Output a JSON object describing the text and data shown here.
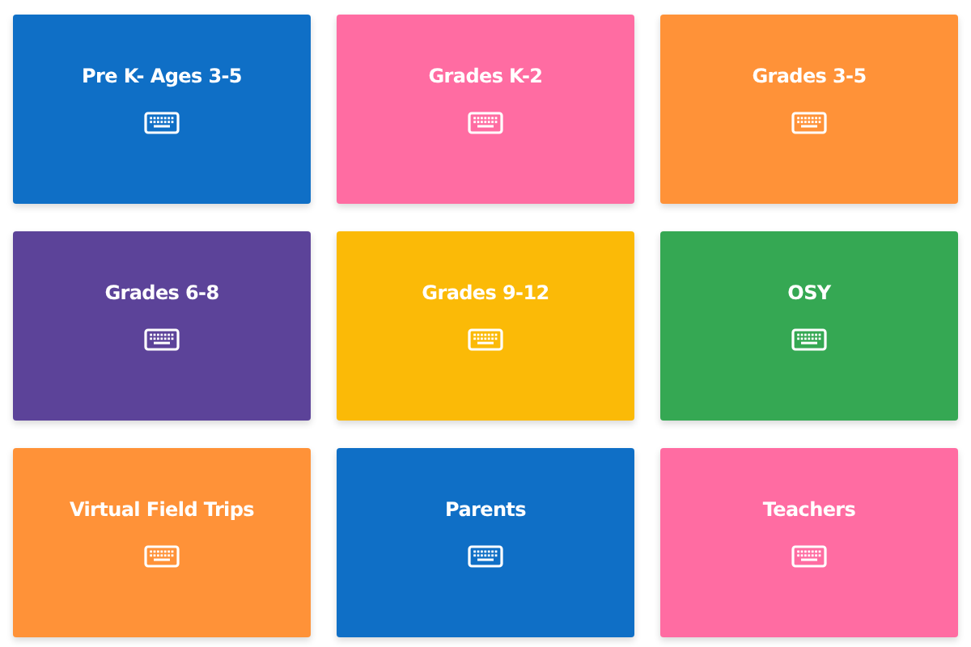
{
  "cards": [
    {
      "title": "Pre K- Ages 3-5",
      "color": "#0f6fc6"
    },
    {
      "title": "Grades K-2",
      "color": "#ff6ca2"
    },
    {
      "title": "Grades 3-5",
      "color": "#ff9238"
    },
    {
      "title": "Grades 6-8",
      "color": "#5c4399"
    },
    {
      "title": "Grades 9-12",
      "color": "#fbba07"
    },
    {
      "title": "OSY",
      "color": "#35a853"
    },
    {
      "title": "Virtual Field Trips",
      "color": "#ff9238"
    },
    {
      "title": "Parents",
      "color": "#0f6fc6"
    },
    {
      "title": "Teachers",
      "color": "#ff6ca2"
    }
  ]
}
